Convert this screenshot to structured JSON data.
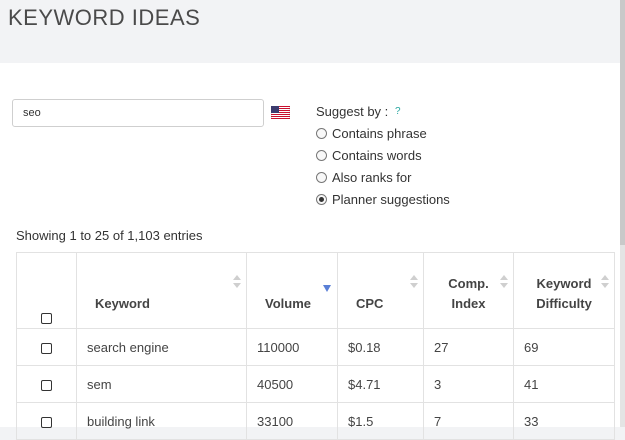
{
  "page": {
    "title": "KEYWORD IDEAS"
  },
  "search": {
    "value": "seo",
    "country_flag_icon": "us-flag-icon"
  },
  "suggest": {
    "label": "Suggest by :",
    "help": "?",
    "options": [
      {
        "label": "Contains phrase",
        "checked": false
      },
      {
        "label": "Contains words",
        "checked": false
      },
      {
        "label": "Also ranks for",
        "checked": false
      },
      {
        "label": "Planner suggestions",
        "checked": true
      }
    ]
  },
  "table": {
    "info": "Showing 1 to 25 of 1,103 entries",
    "headers": {
      "keyword": "Keyword",
      "volume": "Volume",
      "cpc": "CPC",
      "comp_index_line1": "Comp.",
      "comp_index_line2": "Index",
      "difficulty_line1": "Keyword",
      "difficulty_line2": "Difficulty"
    },
    "sorted_column": "volume",
    "sort_direction": "descending",
    "rows": [
      {
        "keyword": "search engine",
        "volume": "110000",
        "cpc": "$0.18",
        "comp_index": "27",
        "difficulty": "69"
      },
      {
        "keyword": "sem",
        "volume": "40500",
        "cpc": "$4.71",
        "comp_index": "3",
        "difficulty": "41"
      },
      {
        "keyword": "building link",
        "volume": "33100",
        "cpc": "$1.5",
        "comp_index": "7",
        "difficulty": "33"
      }
    ]
  },
  "colors": {
    "accent": "#5a7fd6",
    "help": "#2aa7a1",
    "background": "#f2f3f5"
  }
}
